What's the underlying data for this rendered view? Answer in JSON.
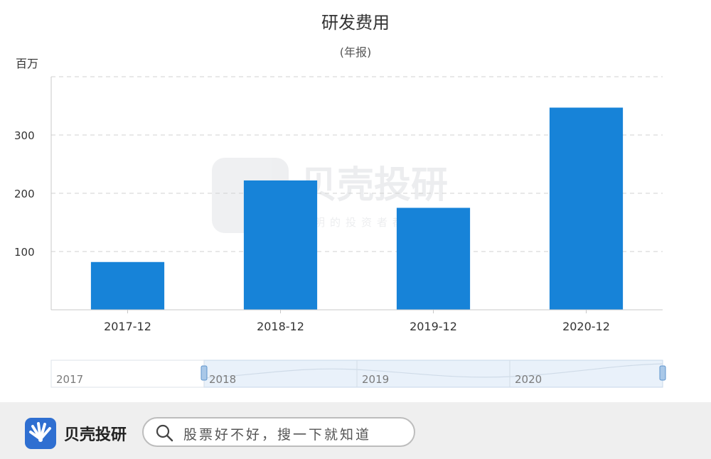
{
  "chart_data": {
    "type": "bar",
    "title": "研发费用",
    "subtitle": "(年报)",
    "unit": "百万",
    "categories": [
      "2017-12",
      "2018-12",
      "2019-12",
      "2020-12"
    ],
    "values": [
      82,
      222,
      175,
      347
    ],
    "ylim": [
      0,
      400
    ],
    "yticks": [
      100,
      200,
      300
    ],
    "grid": true,
    "bar_color": "#1783d8"
  },
  "range_slider": {
    "labels": [
      "2017",
      "2018",
      "2019",
      "2020"
    ],
    "selected_start": "2018",
    "selected_end": "2020"
  },
  "watermark": {
    "brand": "贝壳投研",
    "slogan": "聪明的投资者都在这里"
  },
  "footer": {
    "brand_name": "贝壳投研",
    "search_placeholder": "股票好不好，搜一下就知道",
    "logo_color": "#2f6fd1"
  }
}
